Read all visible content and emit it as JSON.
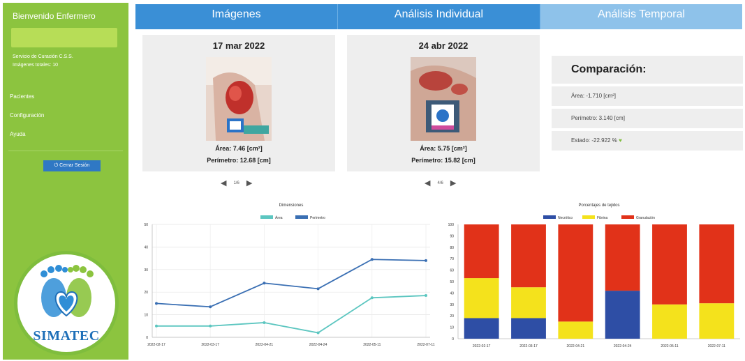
{
  "sidebar": {
    "greeting": "Bienvenido Enfermero",
    "info_lines": [
      "Servicio de Curación C.S.S.",
      "Imágenes totales: 10"
    ],
    "nav": [
      "Pacientes",
      "Configuración",
      "Ayuda"
    ],
    "logout_label": "⏻ Cerrar Sesión",
    "logo_text": "SIMATEC"
  },
  "tabs": [
    {
      "label": "Imágenes",
      "active": true
    },
    {
      "label": "Análisis Individual",
      "active": true
    },
    {
      "label": "Análisis Temporal",
      "active": false
    }
  ],
  "cards": [
    {
      "date": "17 mar 2022",
      "area": "Área: 7.46 [cm²]",
      "perimeter": "Perímetro: 12.68 [cm]",
      "pager": "1/6"
    },
    {
      "date": "24 abr 2022",
      "area": "Área: 5.75 [cm²]",
      "perimeter": "Perímetro: 15.82 [cm]",
      "pager": "4/6"
    }
  ],
  "comparison": {
    "title": "Comparación:",
    "area": "Área: -1.710 [cm²]",
    "perimeter": "Perímetro: 3.140 [cm]",
    "status": "Estado: -22.922 %"
  },
  "colors": {
    "sidebar": "#8cc43f",
    "tab_active": "#3a8fd6",
    "tab_inactive": "#8ec2ea",
    "area_line": "#5cc6c0",
    "perimeter_line": "#3a6fb3",
    "necrotic": "#2e4ea5",
    "fibrin": "#f4e21c",
    "granulation": "#e13219"
  },
  "chart_data": [
    {
      "type": "line",
      "title": "Dimensiones",
      "x": [
        "2022-02-17",
        "2022-03-17",
        "2022-04-21",
        "2022-04-24",
        "2022-05-11",
        "2022-07-11"
      ],
      "series": [
        {
          "name": "Área",
          "values": [
            5,
            5,
            6.5,
            2,
            17.5,
            18.5
          ]
        },
        {
          "name": "Perímetro",
          "values": [
            15,
            13.5,
            24,
            21.5,
            34.5,
            34
          ]
        }
      ],
      "ylim": [
        0,
        50
      ],
      "yticks": [
        0,
        10,
        20,
        30,
        40,
        50
      ],
      "grid": true,
      "legend": "top"
    },
    {
      "type": "bar",
      "title": "Porcentajes de tejidos",
      "stacked": true,
      "categories": [
        "2022-02-17",
        "2022-03-17",
        "2022-04-21",
        "2022-04-24",
        "2022-05-11",
        "2022-07-11"
      ],
      "series": [
        {
          "name": "Necrótico",
          "values": [
            18,
            18,
            0,
            42,
            0,
            0
          ]
        },
        {
          "name": "Fibrina",
          "values": [
            35,
            27,
            15,
            0,
            30,
            31
          ]
        },
        {
          "name": "Granulación",
          "values": [
            47,
            55,
            85,
            58,
            70,
            69
          ]
        }
      ],
      "ylim": [
        0,
        100
      ],
      "yticks": [
        0,
        10,
        20,
        30,
        40,
        50,
        60,
        70,
        80,
        90,
        100
      ],
      "legend": "top"
    }
  ]
}
